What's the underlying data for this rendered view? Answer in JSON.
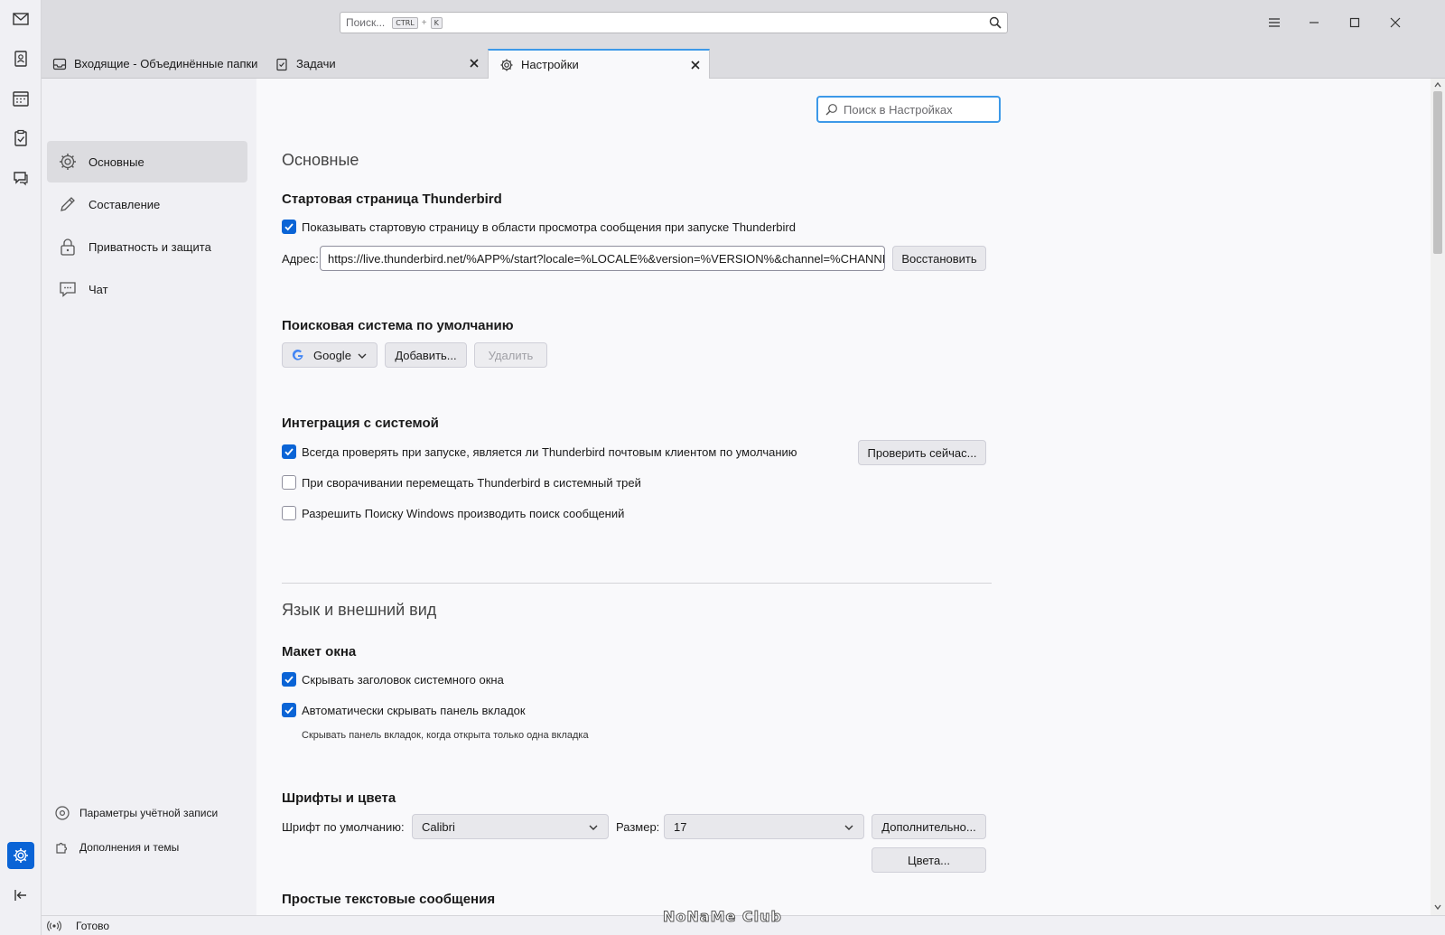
{
  "global_search": {
    "placeholder": "Поиск...",
    "kbd_ctrl": "CTRL",
    "kbd_plus": "+",
    "kbd_k": "K"
  },
  "tabs": [
    {
      "label": "Входящие - Объединённые папки"
    },
    {
      "label": "Задачи"
    },
    {
      "label": "Настройки"
    }
  ],
  "nav": {
    "items": [
      {
        "label": "Основные"
      },
      {
        "label": "Составление"
      },
      {
        "label": "Приватность и защита"
      },
      {
        "label": "Чат"
      }
    ],
    "account_settings": "Параметры учётной записи",
    "addons_themes": "Дополнения и темы"
  },
  "pref_search": {
    "placeholder": "Поиск в Настройках"
  },
  "general": {
    "title": "Основные",
    "start_page": {
      "heading": "Стартовая страница Thunderbird",
      "show_checkbox": "Показывать стартовую страницу в области просмотра сообщения при запуске Thunderbird",
      "address_label": "Адрес:",
      "address_value": "https://live.thunderbird.net/%APP%/start?locale=%LOCALE%&version=%VERSION%&channel=%CHANNEL%",
      "restore_button": "Восстановить"
    },
    "search_engine": {
      "heading": "Поисковая система по умолчанию",
      "selected": "Google",
      "add_button": "Добавить...",
      "remove_button": "Удалить"
    },
    "integration": {
      "heading": "Интеграция с системой",
      "check_default": "Всегда проверять при запуске, является ли Thunderbird почтовым клиентом по умолчанию",
      "check_now_button": "Проверить сейчас...",
      "minimize_tray": "При сворачивании перемещать Thunderbird в системный трей",
      "windows_search": "Разрешить Поиску Windows производить поиск сообщений"
    }
  },
  "appearance": {
    "title": "Язык и внешний вид",
    "layout": {
      "heading": "Макет окна",
      "hide_titlebar": "Скрывать заголовок системного окна",
      "autohide_tabs": "Автоматически скрывать панель вкладок",
      "autohide_hint": "Скрывать панель вкладок, когда открыта только одна вкладка"
    },
    "fonts": {
      "heading": "Шрифты и цвета",
      "default_font_label": "Шрифт по умолчанию:",
      "default_font_value": "Calibri",
      "size_label": "Размер:",
      "size_value": "17",
      "advanced_button": "Дополнительно...",
      "colors_button": "Цвета..."
    },
    "plain_text_heading": "Простые текстовые сообщения"
  },
  "status": {
    "text": "Готово"
  },
  "watermark": "NoNaMe Club",
  "colors": {
    "accent": "#0a64d6",
    "focus": "#3d99e8"
  }
}
